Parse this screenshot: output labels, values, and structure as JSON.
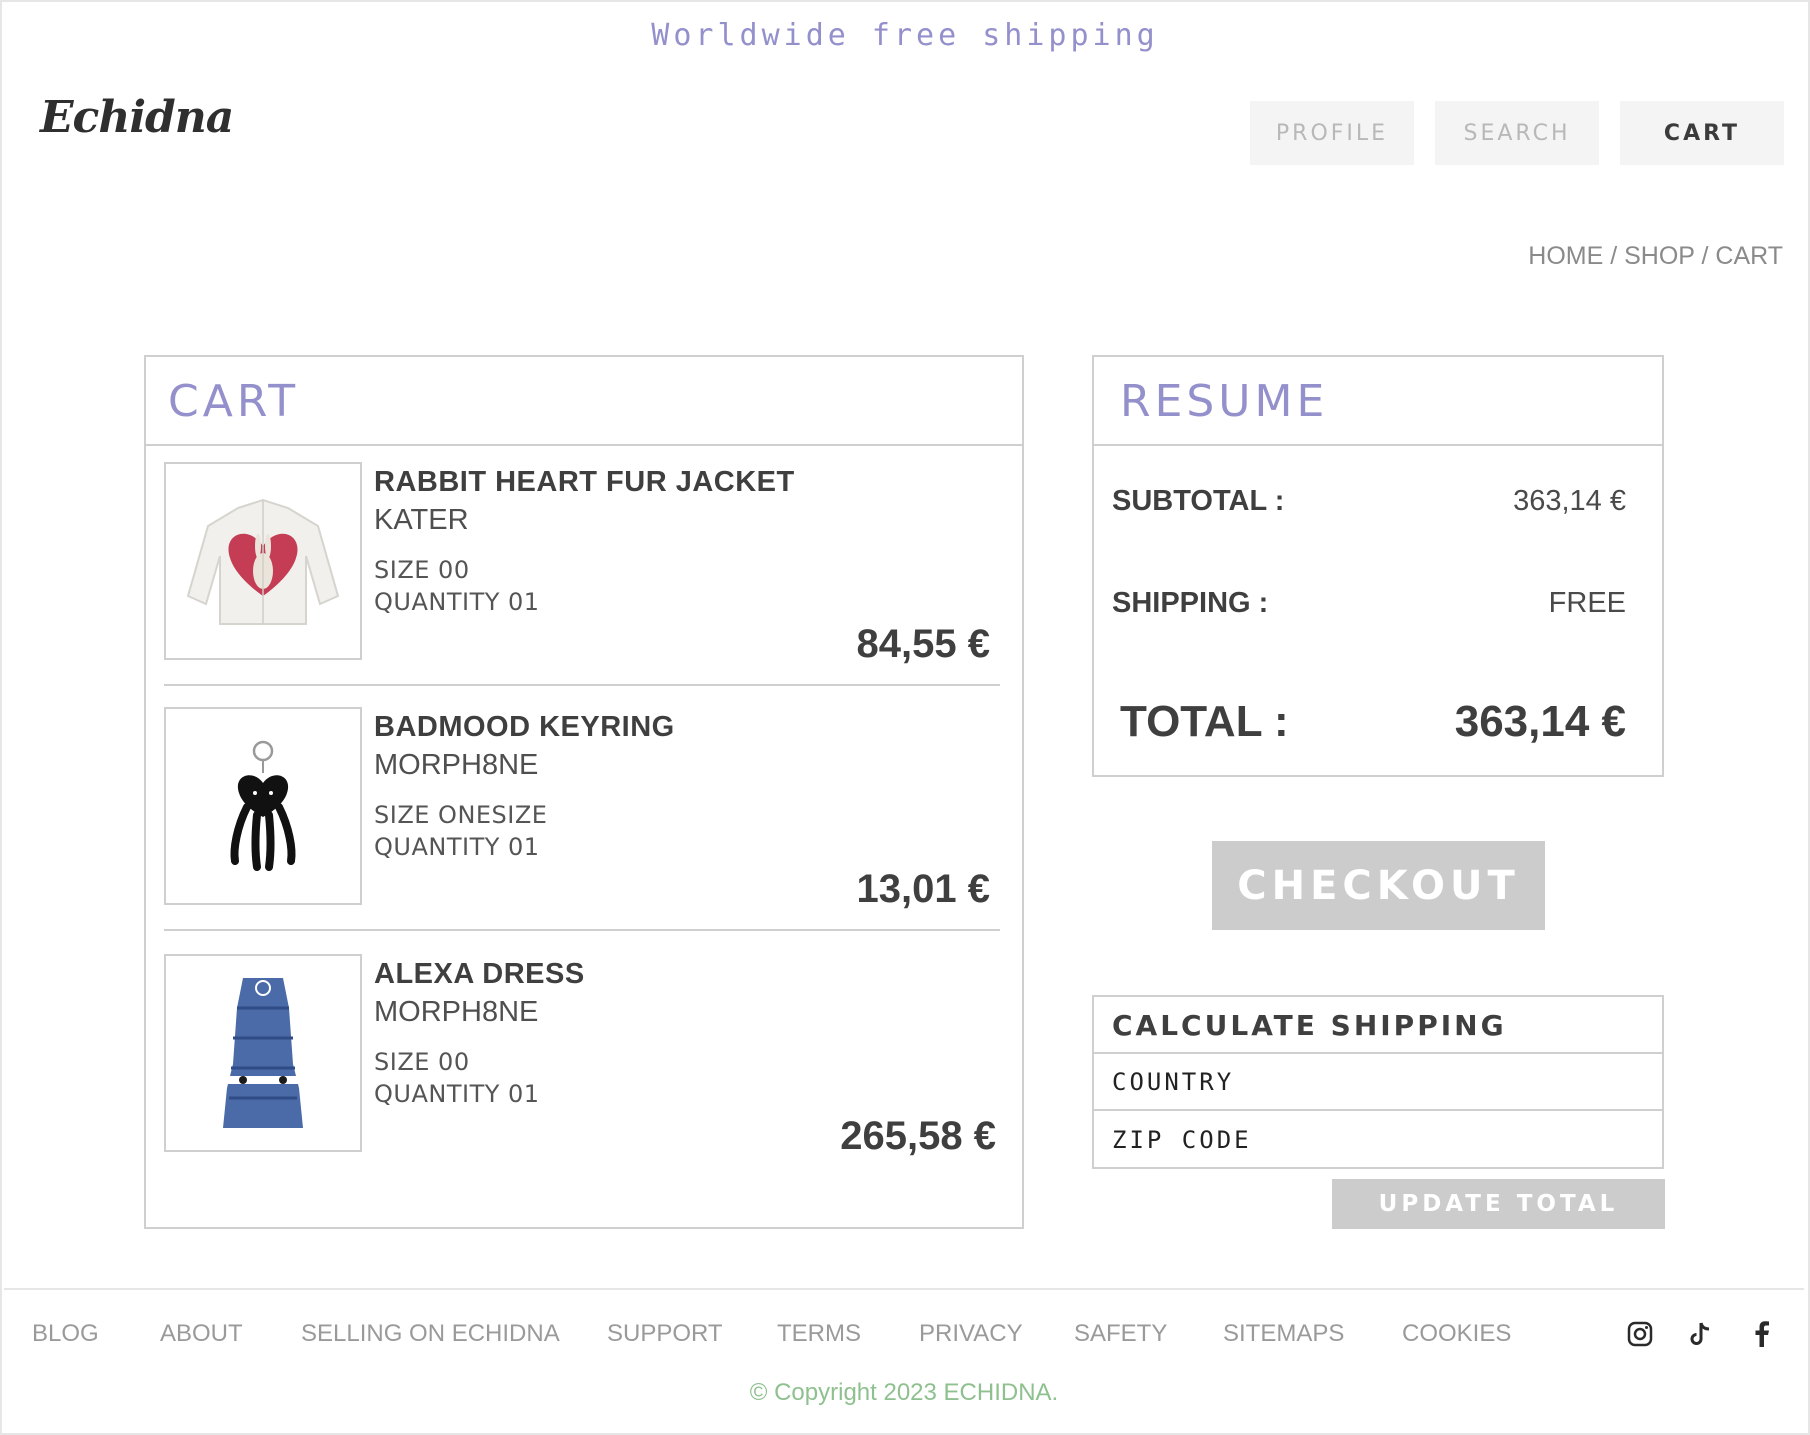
{
  "banner": {
    "text": "Worldwide free shipping"
  },
  "brand": {
    "logo_text": "Echidna"
  },
  "nav": {
    "profile_label": "PROFILE",
    "search_label": "SEARCH",
    "cart_label": "CART"
  },
  "breadcrumb": {
    "home": "HOME",
    "sep": "/",
    "shop": "SHOP",
    "cart": "CART"
  },
  "cart": {
    "title": "CART",
    "items": [
      {
        "name": "RABBIT HEART FUR JACKET",
        "brand": "KATER",
        "size": "SIZE 00",
        "quantity": "QUANTITY 01",
        "price": "84,55 €",
        "image_icon": "jacket-image"
      },
      {
        "name": "BADMOOD KEYRING",
        "brand": "MORPH8NE",
        "size": "SIZE ONESIZE",
        "quantity": "QUANTITY 01",
        "price": "13,01 €",
        "image_icon": "keyring-image"
      },
      {
        "name": "ALEXA DRESS",
        "brand": "MORPH8NE",
        "size": "SIZE 00",
        "quantity": "QUANTITY 01",
        "price": "265,58 €",
        "image_icon": "dress-image"
      }
    ]
  },
  "resume": {
    "title": "RESUME",
    "subtotal_label": "SUBTOTAL :",
    "subtotal_value": "363,14 €",
    "shipping_label": "SHIPPING :",
    "shipping_value": "FREE",
    "total_label": "TOTAL :",
    "total_value": "363,14 €"
  },
  "checkout": {
    "label": "CHECKOUT"
  },
  "shipping_calc": {
    "title": "CALCULATE SHIPPING",
    "country_placeholder": "COUNTRY",
    "zip_placeholder": "ZIP CODE",
    "update_label": "UPDATE TOTAL"
  },
  "footer": {
    "links": [
      "BLOG",
      "ABOUT",
      "SELLING ON ECHIDNA",
      "SUPPORT",
      "TERMS",
      "PRIVACY",
      "SAFETY",
      "SITEMAPS",
      "COOKIES"
    ],
    "social_icons": [
      "instagram-icon",
      "tiktok-icon",
      "facebook-icon"
    ],
    "copyright": "© Copyright 2023 ECHIDNA."
  },
  "colors": {
    "accent": "#9490cc",
    "copyright": "#8fc08f",
    "button_disabled": "#cccccc"
  }
}
